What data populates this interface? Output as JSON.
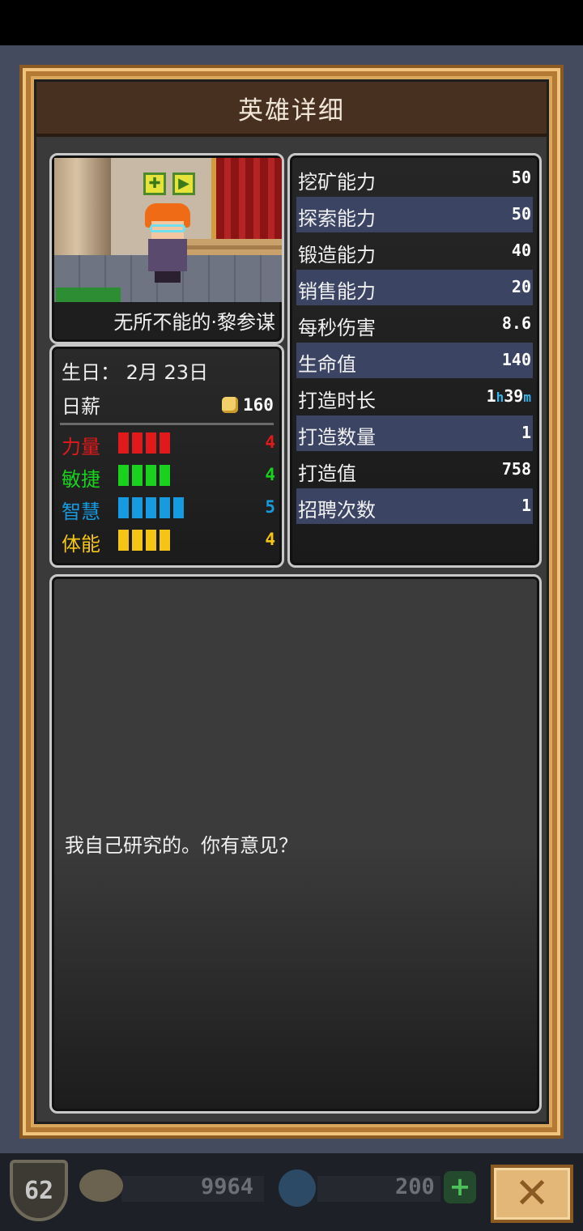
{
  "dialog": {
    "title": "英雄详细"
  },
  "hero": {
    "name": "无所不能的·黎参谋",
    "birthday": "生日：  2月 23日",
    "salary_label": "日薪",
    "salary_value": "160",
    "buffs": [
      "buff-icon",
      "buff-icon"
    ]
  },
  "attributes": [
    {
      "label": "力量",
      "value": "4",
      "count": 4,
      "color": "#e0191b"
    },
    {
      "label": "敏捷",
      "value": "4",
      "count": 4,
      "color": "#18d21d"
    },
    {
      "label": "智慧",
      "value": "5",
      "count": 5,
      "color": "#169ae0"
    },
    {
      "label": "体能",
      "value": "4",
      "count": 4,
      "color": "#f5c516"
    }
  ],
  "stats": [
    {
      "label": "挖矿能力",
      "value": "50"
    },
    {
      "label": "探索能力",
      "value": "50"
    },
    {
      "label": "锻造能力",
      "value": "40"
    },
    {
      "label": "销售能力",
      "value": "20"
    },
    {
      "label": "每秒伤害",
      "value": "8.6"
    },
    {
      "label": "生命值",
      "value": "140"
    },
    {
      "label": "打造时长",
      "value_hours": "1",
      "unit_h": "h",
      "value_minutes": "39",
      "unit_m": "m"
    },
    {
      "label": "打造数量",
      "value": "1"
    },
    {
      "label": "打造值",
      "value": "758"
    },
    {
      "label": "招聘次数",
      "value": "1"
    }
  ],
  "quote": "我自己研究的。你有意见？",
  "bottom": {
    "level": "62",
    "stone_value": "9964",
    "gem_value": "200",
    "plus_label": "+",
    "close_label": "✕"
  }
}
